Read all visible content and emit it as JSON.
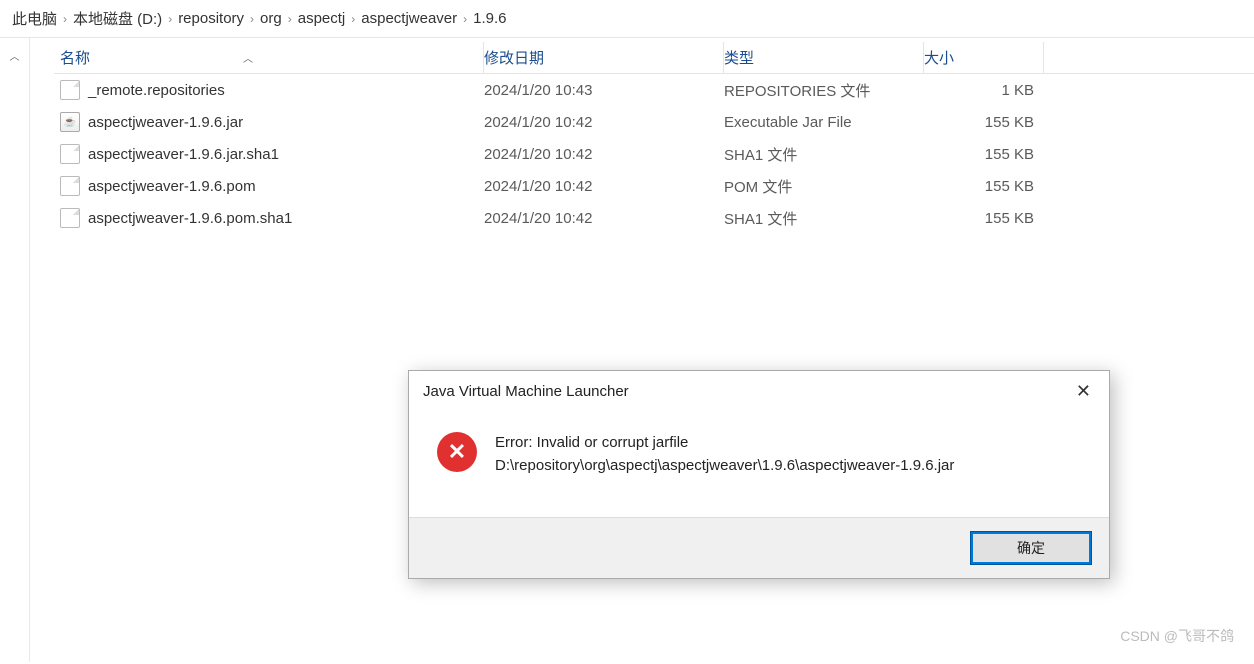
{
  "breadcrumb": {
    "items": [
      {
        "label": "此电脑"
      },
      {
        "label": "本地磁盘 (D:)"
      },
      {
        "label": "repository"
      },
      {
        "label": "org"
      },
      {
        "label": "aspectj"
      },
      {
        "label": "aspectjweaver"
      },
      {
        "label": "1.9.6"
      }
    ]
  },
  "columns": {
    "name": "名称",
    "date": "修改日期",
    "type": "类型",
    "size": "大小"
  },
  "files": [
    {
      "icon": "generic",
      "name": "_remote.repositories",
      "date": "2024/1/20 10:43",
      "type": "REPOSITORIES 文件",
      "size": "1 KB"
    },
    {
      "icon": "jar",
      "name": "aspectjweaver-1.9.6.jar",
      "date": "2024/1/20 10:42",
      "type": "Executable Jar File",
      "size": "155 KB"
    },
    {
      "icon": "generic",
      "name": "aspectjweaver-1.9.6.jar.sha1",
      "date": "2024/1/20 10:42",
      "type": "SHA1 文件",
      "size": "155 KB"
    },
    {
      "icon": "generic",
      "name": "aspectjweaver-1.9.6.pom",
      "date": "2024/1/20 10:42",
      "type": "POM 文件",
      "size": "155 KB"
    },
    {
      "icon": "generic",
      "name": "aspectjweaver-1.9.6.pom.sha1",
      "date": "2024/1/20 10:42",
      "type": "SHA1 文件",
      "size": "155 KB"
    }
  ],
  "dialog": {
    "title": "Java Virtual Machine Launcher",
    "line1": "Error: Invalid or corrupt jarfile",
    "line2": "D:\\repository\\org\\aspectj\\aspectjweaver\\1.9.6\\aspectjweaver-1.9.6.jar",
    "ok": "确定"
  },
  "watermark": "CSDN @飞哥不鸽"
}
